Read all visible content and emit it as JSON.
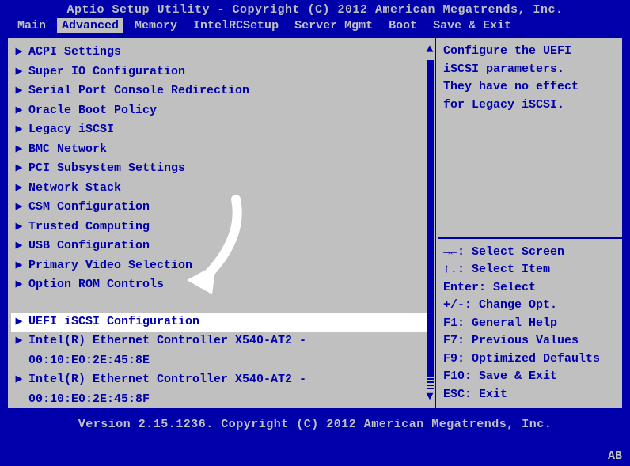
{
  "header": {
    "title": "Aptio Setup Utility - Copyright (C) 2012 American Megatrends, Inc."
  },
  "tabs": [
    {
      "label": "Main",
      "active": false
    },
    {
      "label": "Advanced",
      "active": true
    },
    {
      "label": "Memory",
      "active": false
    },
    {
      "label": "IntelRCSetup",
      "active": false
    },
    {
      "label": "Server Mgmt",
      "active": false
    },
    {
      "label": "Boot",
      "active": false
    },
    {
      "label": "Save & Exit",
      "active": false
    }
  ],
  "menu": {
    "items": [
      {
        "label": "ACPI Settings",
        "arrow": true
      },
      {
        "label": "Super IO Configuration",
        "arrow": true
      },
      {
        "label": "Serial Port Console Redirection",
        "arrow": true
      },
      {
        "label": "Oracle Boot Policy",
        "arrow": true
      },
      {
        "label": "Legacy iSCSI",
        "arrow": true
      },
      {
        "label": "BMC Network",
        "arrow": true
      },
      {
        "label": "PCI Subsystem Settings",
        "arrow": true
      },
      {
        "label": "Network Stack",
        "arrow": true
      },
      {
        "label": "CSM Configuration",
        "arrow": true
      },
      {
        "label": "Trusted Computing",
        "arrow": true
      },
      {
        "label": "USB Configuration",
        "arrow": true
      },
      {
        "label": "Primary Video Selection",
        "arrow": true
      },
      {
        "label": "Option ROM Controls",
        "arrow": true
      }
    ],
    "selected": {
      "label": "UEFI iSCSI Configuration",
      "arrow": true
    },
    "after": [
      {
        "label": "Intel(R) Ethernet Controller X540-AT2 -",
        "sub": "00:10:E0:2E:45:8E",
        "arrow": true
      },
      {
        "label": "Intel(R) Ethernet Controller X540-AT2 -",
        "sub": "00:10:E0:2E:45:8F",
        "arrow": true
      }
    ]
  },
  "help": {
    "lines": [
      "Configure the UEFI",
      "iSCSI parameters.",
      "They have no effect",
      "for Legacy iSCSI."
    ],
    "keys": [
      "→←: Select Screen",
      "↑↓: Select Item",
      "Enter: Select",
      "+/-: Change Opt.",
      "F1: General Help",
      "F7: Previous Values",
      "F9: Optimized Defaults",
      "F10: Save & Exit",
      "ESC: Exit"
    ]
  },
  "footer": {
    "text": "Version 2.15.1236. Copyright (C) 2012 American Megatrends, Inc."
  },
  "status": {
    "corner": "AB"
  },
  "glyphs": {
    "submenu": "▶",
    "scroll_up": "▲",
    "scroll_down": "▼"
  }
}
